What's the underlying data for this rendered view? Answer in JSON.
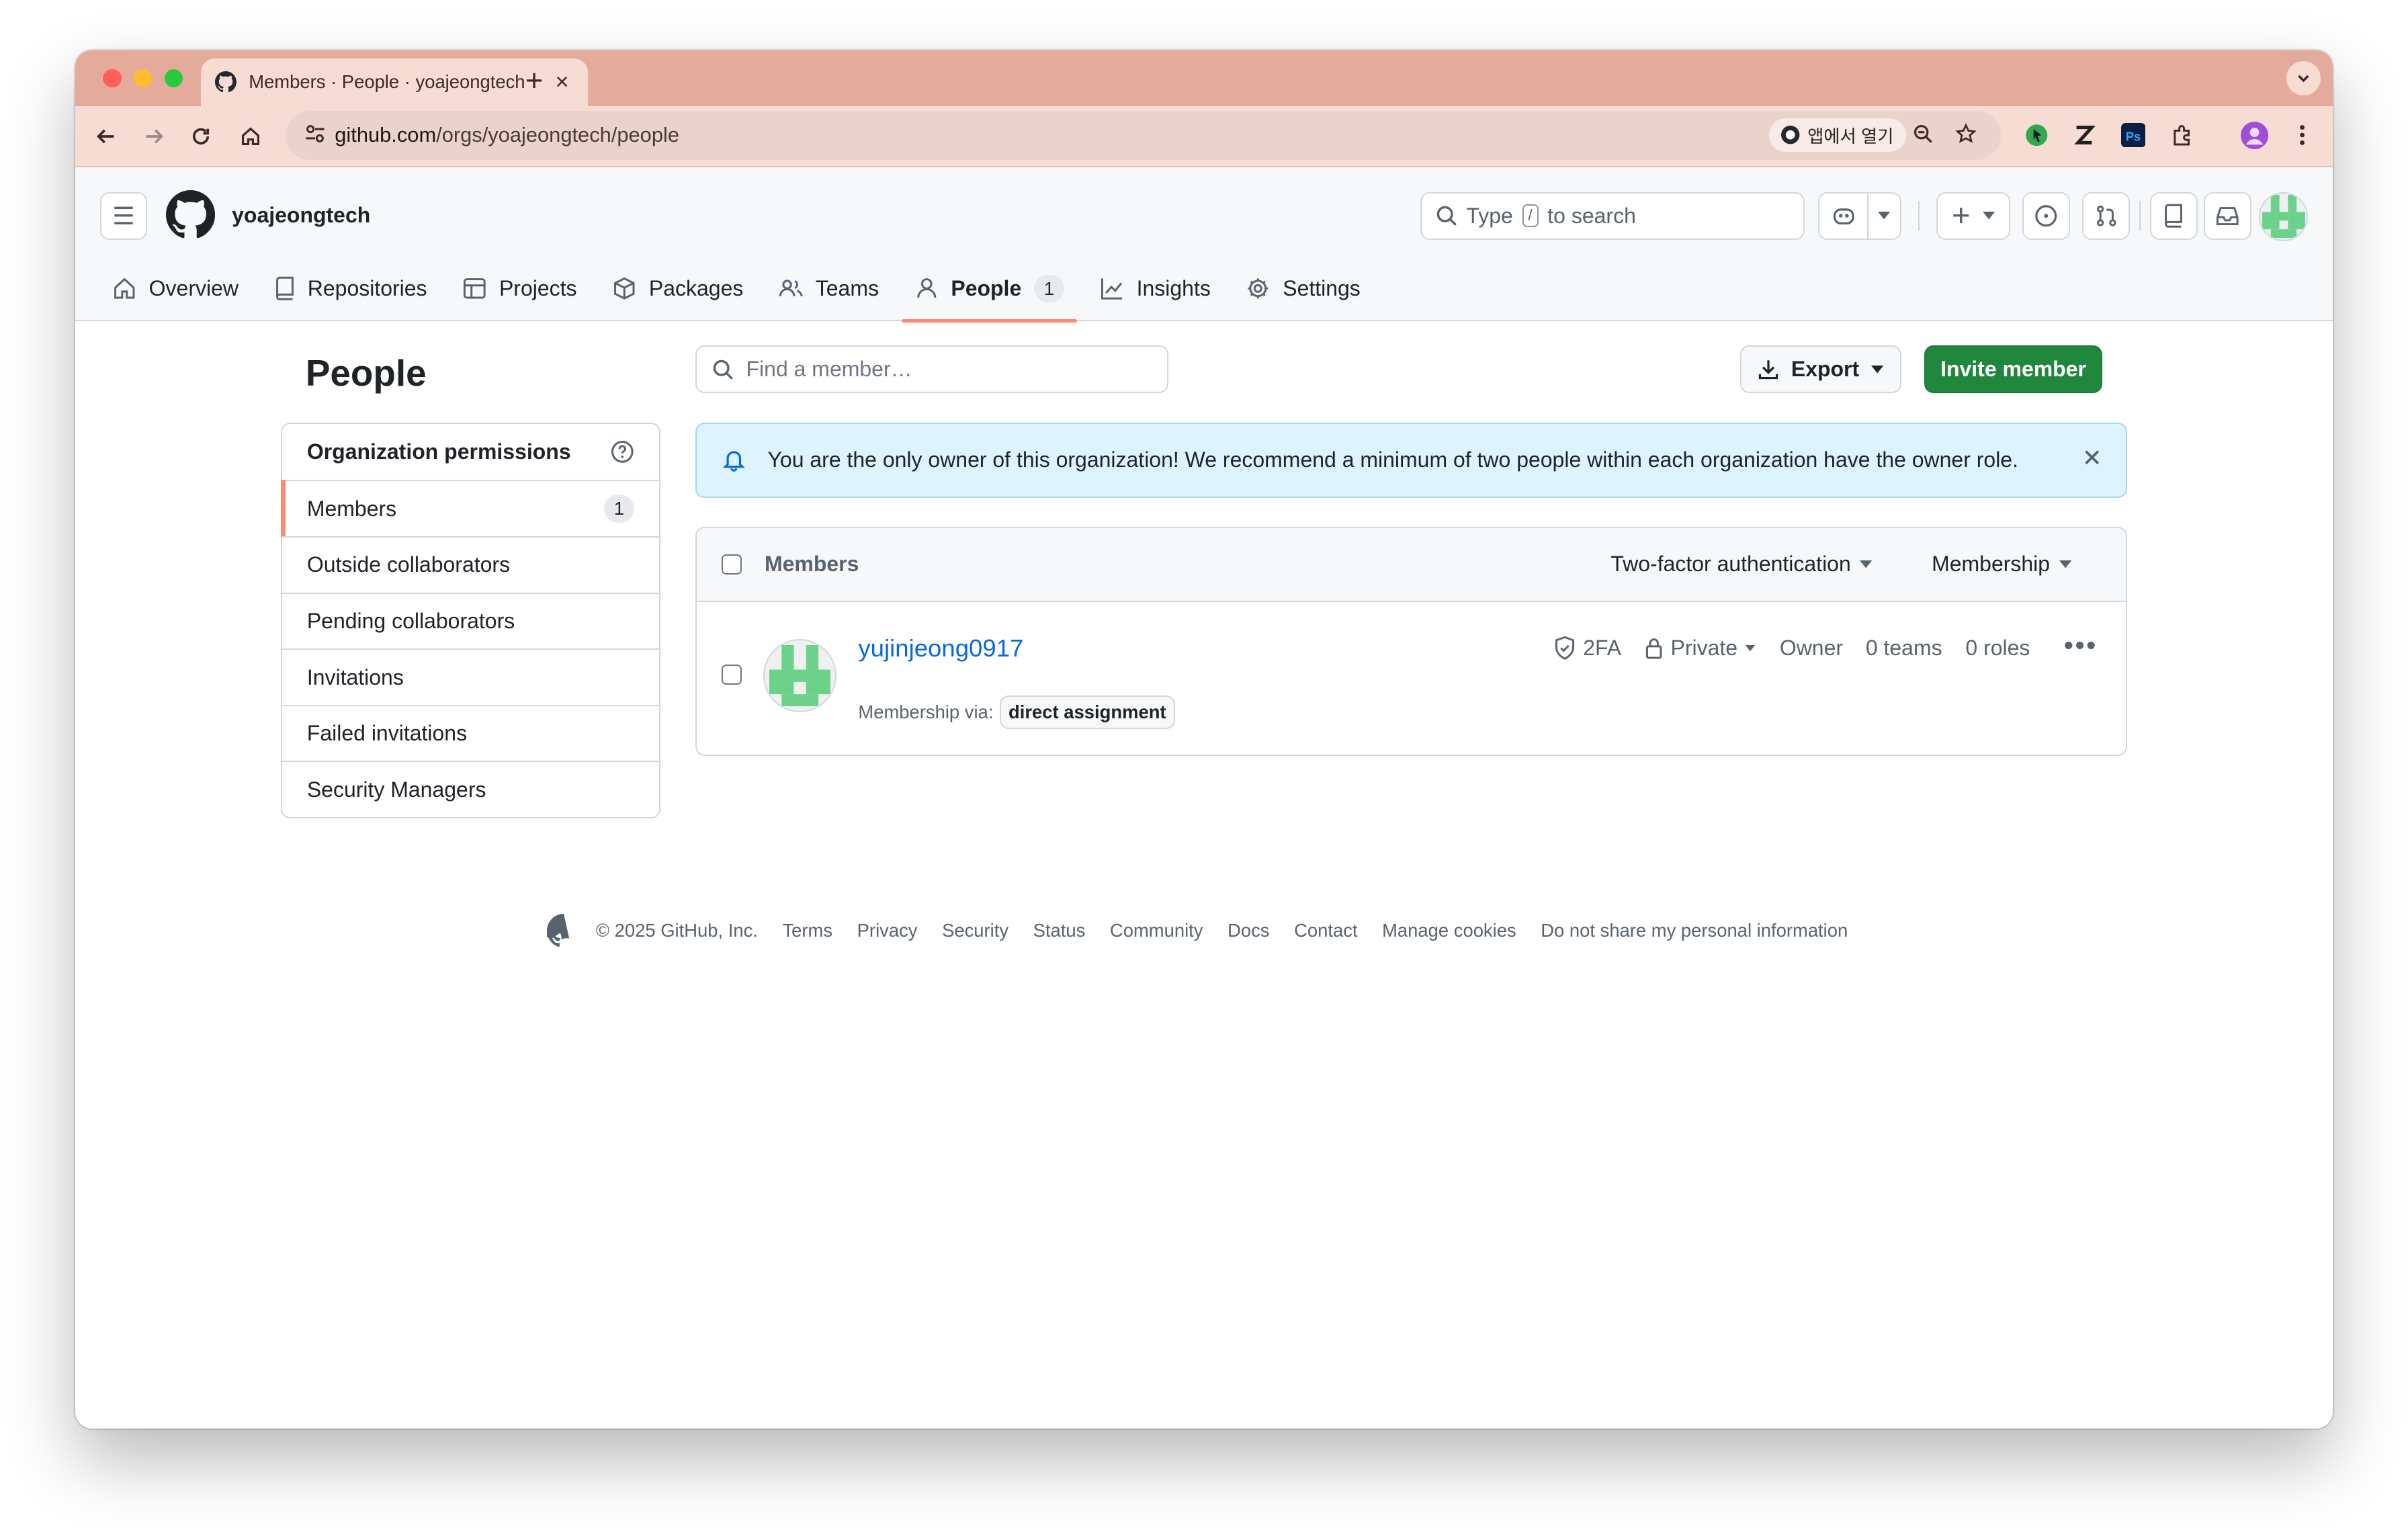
{
  "browser": {
    "tab_title": "Members · People · yoajeongtech",
    "url_host": "github.com",
    "url_path": "/orgs/yoajeongtech/people",
    "open_in_app": "앱에서 열기"
  },
  "header": {
    "org_name": "yoajeongtech",
    "search_prefix": "Type",
    "search_key": "/",
    "search_suffix": "to search"
  },
  "org_nav": [
    {
      "label": "Overview"
    },
    {
      "label": "Repositories"
    },
    {
      "label": "Projects"
    },
    {
      "label": "Packages"
    },
    {
      "label": "Teams"
    },
    {
      "label": "People",
      "count": "1"
    },
    {
      "label": "Insights"
    },
    {
      "label": "Settings"
    }
  ],
  "page": {
    "title": "People",
    "find_placeholder": "Find a member…",
    "export_label": "Export",
    "invite_label": "Invite member"
  },
  "sidebar": {
    "header": "Organization permissions",
    "items": [
      {
        "label": "Members",
        "count": "1"
      },
      {
        "label": "Outside collaborators"
      },
      {
        "label": "Pending collaborators"
      },
      {
        "label": "Invitations"
      },
      {
        "label": "Failed invitations"
      },
      {
        "label": "Security Managers"
      }
    ]
  },
  "banner": {
    "text": "You are the only owner of this organization! We recommend a minimum of two people within each organization have the owner role."
  },
  "members": {
    "header_label": "Members",
    "filter_2fa": "Two-factor authentication",
    "filter_membership": "Membership",
    "rows": [
      {
        "username": "yujinjeong0917",
        "membership_via_label": "Membership via:",
        "membership_via": "direct assignment",
        "twofa": "2FA",
        "visibility": "Private",
        "role": "Owner",
        "teams": "0 teams",
        "roles": "0 roles"
      }
    ]
  },
  "footer": {
    "copyright": "© 2025 GitHub, Inc.",
    "links": [
      "Terms",
      "Privacy",
      "Security",
      "Status",
      "Community",
      "Docs",
      "Contact",
      "Manage cookies",
      "Do not share my personal information"
    ]
  },
  "colors": {
    "tab_strip": "#e4ab9b",
    "accent_underline": "#fd8c73",
    "primary_button": "#1f883d",
    "link": "#0969da",
    "banner_bg": "#ddf4ff"
  }
}
